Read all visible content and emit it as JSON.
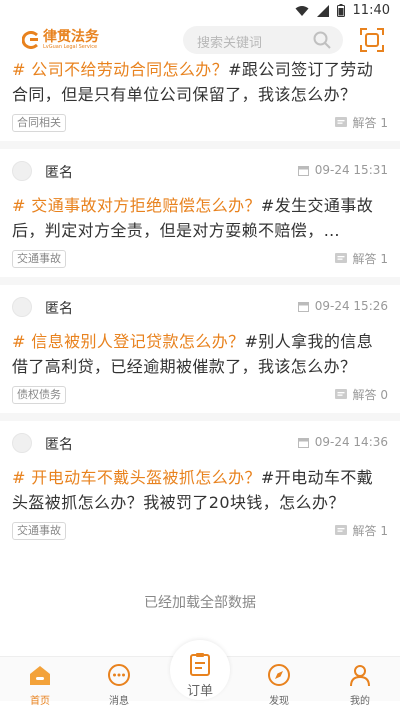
{
  "status_bar": {
    "time": "11:40"
  },
  "header": {
    "logo_text": "律贯法务",
    "logo_sub": "LvGuan Legal Service",
    "search_placeholder": "搜索关键词"
  },
  "questions": [
    {
      "title": "# 公司不给劳动合同怎么办？",
      "body": "#跟公司签订了劳动合同，但是只有单位公司保留了，我该怎么办？",
      "tag": "合同相关",
      "answers": "解答 1"
    },
    {
      "author": "匿名",
      "date": "09-24 15:31",
      "title": "# 交通事故对方拒绝赔偿怎么办？",
      "body": "#发生交通事故后，判定对方全责，但是对方耍赖不赔偿，…",
      "tag": "交通事故",
      "answers": "解答 1"
    },
    {
      "author": "匿名",
      "date": "09-24 15:26",
      "title": "# 信息被别人登记贷款怎么办？",
      "body": "#别人拿我的信息借了高利贷，已经逾期被催款了，我该怎么办？",
      "tag": "债权债务",
      "answers": "解答 0"
    },
    {
      "author": "匿名",
      "date": "09-24 14:36",
      "title": "# 开电动车不戴头盔被抓怎么办？",
      "body": "#开电动车不戴头盔被抓怎么办？我被罚了20块钱，怎么办？",
      "tag": "交通事故",
      "answers": "解答 1"
    }
  ],
  "loaded_text": "已经加载全部数据",
  "tabs": {
    "home": "首页",
    "messages": "消息",
    "orders": "订单",
    "discover": "发现",
    "mine": "我的"
  },
  "colors": {
    "accent": "#e8821e"
  }
}
